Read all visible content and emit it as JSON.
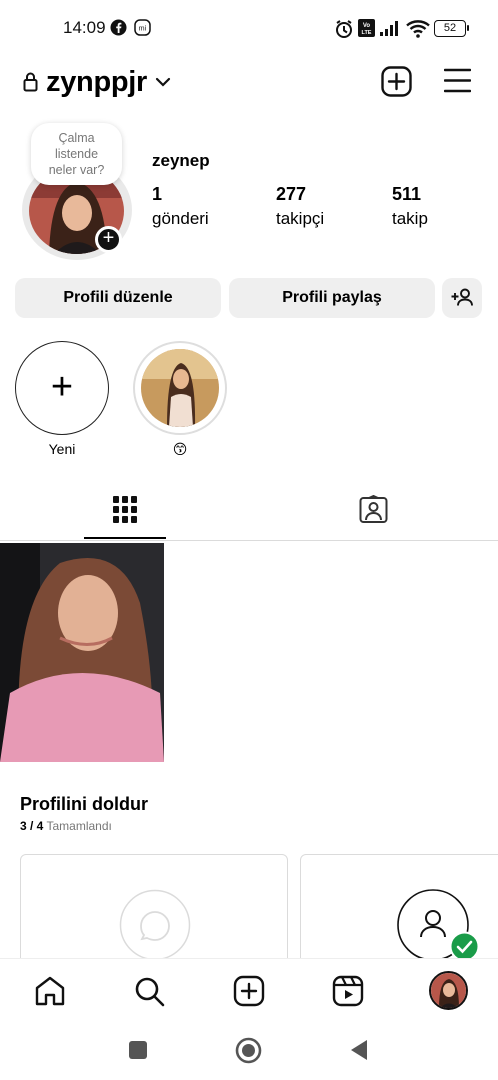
{
  "status_bar": {
    "time": "14:09",
    "battery": "52",
    "icons": [
      "facebook-icon",
      "mi-icon",
      "alarm-icon",
      "volte-icon",
      "signal-icon",
      "wifi-icon",
      "battery-icon"
    ]
  },
  "header": {
    "username": "zynppjr",
    "icons": [
      "lock-icon",
      "chevron-down-icon",
      "create-icon",
      "menu-icon"
    ]
  },
  "profile": {
    "note": [
      "Çalma",
      "listende",
      "neler var?"
    ],
    "display_name": "zeynep",
    "stats": [
      {
        "number": "1",
        "label": "gönderi"
      },
      {
        "number": "277",
        "label": "takipçi"
      },
      {
        "number": "511",
        "label": "takip"
      }
    ]
  },
  "actions": {
    "edit_label": "Profili düzenle",
    "share_label": "Profili paylaş",
    "discover_icon": "add-person-icon"
  },
  "highlights": {
    "new_label": "Yeni",
    "items": [
      {
        "label": "😙"
      }
    ]
  },
  "tabs": {
    "items": [
      "grid-icon",
      "tagged-icon"
    ],
    "active": "grid-icon"
  },
  "complete_profile": {
    "title": "Profilini doldur",
    "progress": "3 / 4",
    "progress_label": "Tamamlandı",
    "progress_fraction": 0.75
  },
  "bottom_nav": {
    "items": [
      "home-icon",
      "search-icon",
      "create-icon",
      "reels-icon",
      "profile-avatar"
    ]
  },
  "system_nav": {
    "items": [
      "recents-button",
      "home-button",
      "back-button"
    ]
  },
  "colors": {
    "text": "#000000",
    "button_bg": "#efefef",
    "muted": "#777777",
    "verified_green": "#1a9c49"
  }
}
